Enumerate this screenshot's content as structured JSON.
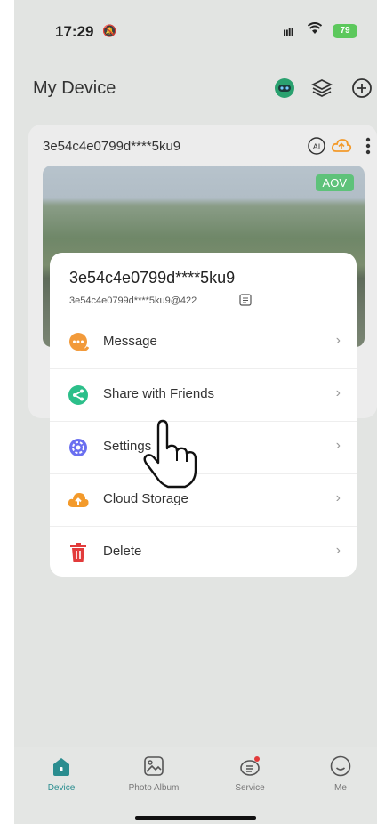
{
  "status_bar": {
    "time": "17:29",
    "battery": "79"
  },
  "header": {
    "title": "My Device"
  },
  "device_card": {
    "device_id": "3e54c4e0799d****5ku9",
    "badge": "AOV"
  },
  "popup": {
    "title": "3e54c4e0799d****5ku9",
    "subtitle": "3e54c4e0799d****5ku9@422",
    "items": [
      {
        "label": "Message",
        "icon": "message-icon",
        "color": "#f29a3a"
      },
      {
        "label": "Share with Friends",
        "icon": "share-icon",
        "color": "#2cbf8a"
      },
      {
        "label": "Settings",
        "icon": "settings-icon",
        "color": "#6a6ff0"
      },
      {
        "label": "Cloud Storage",
        "icon": "cloud-storage-icon",
        "color": "#f39a2b"
      },
      {
        "label": "Delete",
        "icon": "trash-icon",
        "color": "#e23b3b"
      }
    ]
  },
  "tabbar": {
    "tabs": [
      {
        "label": "Device",
        "active": true
      },
      {
        "label": "Photo Album",
        "active": false
      },
      {
        "label": "Service",
        "active": false
      },
      {
        "label": "Me",
        "active": false
      }
    ],
    "accent": "#2a8d8f"
  }
}
